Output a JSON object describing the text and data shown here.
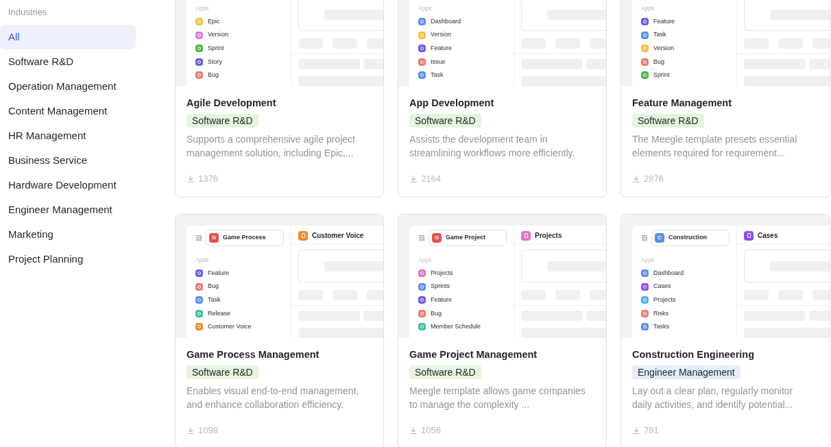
{
  "sidebar": {
    "heading": "Industries",
    "items": [
      {
        "label": "All",
        "selected": true
      },
      {
        "label": "Software R&D",
        "selected": false
      },
      {
        "label": "Operation Management",
        "selected": false
      },
      {
        "label": "Content Management",
        "selected": false
      },
      {
        "label": "HR Management",
        "selected": false
      },
      {
        "label": "Business Service",
        "selected": false
      },
      {
        "label": "Hardware Development",
        "selected": false
      },
      {
        "label": "Engineer Management",
        "selected": false
      },
      {
        "label": "Marketing",
        "selected": false
      },
      {
        "label": "Project Planning",
        "selected": false
      }
    ]
  },
  "templates": [
    {
      "title": "Agile Development",
      "tag": {
        "label": "Software R&D",
        "color": "#e4f5dd"
      },
      "description": "Supports a comprehensive agile project management solution, including Epic,...",
      "downloads": "1376",
      "preview": {
        "apps_label": "Apps",
        "apps": [
          {
            "label": "Epic",
            "color": "#f7c23c"
          },
          {
            "label": "Version",
            "color": "#d77fdd"
          },
          {
            "label": "Sprint",
            "color": "#4cb84c"
          },
          {
            "label": "Story",
            "color": "#6a5ee8"
          },
          {
            "label": "Bug",
            "color": "#ec7b73"
          }
        ]
      }
    },
    {
      "title": "App Development",
      "tag": {
        "label": "Software R&D",
        "color": "#e4f5dd"
      },
      "description": "Assists the development team in streamlining workflows more efficiently.",
      "downloads": "2164",
      "preview": {
        "apps_label": "Apps",
        "apps": [
          {
            "label": "Dashboard",
            "color": "#5b8ff2"
          },
          {
            "label": "Version",
            "color": "#f7c23c"
          },
          {
            "label": "Feature",
            "color": "#6a5ee8"
          },
          {
            "label": "Issue",
            "color": "#ec7b73"
          },
          {
            "label": "Task",
            "color": "#5b8ff2"
          }
        ]
      }
    },
    {
      "title": "Feature Management",
      "tag": {
        "label": "Software R&D",
        "color": "#e4f5dd"
      },
      "description": "The Meegle template presets essential elements required for requirement...",
      "downloads": "2876",
      "preview": {
        "apps_label": "Apps",
        "apps": [
          {
            "label": "Feature",
            "color": "#6a5ee8"
          },
          {
            "label": "Task",
            "color": "#5b8ff2"
          },
          {
            "label": "Version",
            "color": "#f7c23c"
          },
          {
            "label": "Bug",
            "color": "#ec7b73"
          },
          {
            "label": "Sprint",
            "color": "#4cb84c"
          }
        ]
      }
    },
    {
      "title": "Game Process Management",
      "tag": {
        "label": "Software R&D",
        "color": "#e4f5dd"
      },
      "description": "Enables visual end-to-end management, and enhance collaboration efficiency.",
      "downloads": "1098",
      "preview": {
        "space": {
          "letter": "G",
          "color": "#e5524a",
          "name": "Game Process"
        },
        "panel": {
          "title": "Customer Voice",
          "color": "#f08a2c"
        },
        "apps_label": "Apps",
        "apps": [
          {
            "label": "Feature",
            "color": "#6a5ee8"
          },
          {
            "label": "Bug",
            "color": "#ec7b73"
          },
          {
            "label": "Task",
            "color": "#5b8ff2"
          },
          {
            "label": "Release",
            "color": "#3fbf9f"
          },
          {
            "label": "Customer Voice",
            "color": "#f08a2c"
          }
        ]
      }
    },
    {
      "title": "Game Project Management",
      "tag": {
        "label": "Software R&D",
        "color": "#e4f5dd"
      },
      "description": "Meegle template allows game companies to manage the complexity ...",
      "downloads": "1056",
      "preview": {
        "space": {
          "letter": "G",
          "color": "#e5524a",
          "name": "Game Project"
        },
        "panel": {
          "title": "Projects",
          "color": "#e472c4"
        },
        "apps_label": "Apps",
        "apps": [
          {
            "label": "Projects",
            "color": "#e472c4"
          },
          {
            "label": "Sprints",
            "color": "#5b8ff2"
          },
          {
            "label": "Feature",
            "color": "#6a5ee8"
          },
          {
            "label": "Bug",
            "color": "#ec7b73"
          },
          {
            "label": "Member Schedule",
            "color": "#3fbf9f"
          }
        ]
      }
    },
    {
      "title": "Construction Engineering",
      "tag": {
        "label": "Engineer Management",
        "color": "#e5ecfb"
      },
      "description": "Lay out a clear plan, regularly monitor daily activities, and identify potential...",
      "downloads": "791",
      "preview": {
        "space": {
          "letter": "C",
          "color": "#5b8ff2",
          "name": "Construction"
        },
        "panel": {
          "title": "Cases",
          "color": "#8b4ff0"
        },
        "apps_label": "Apps",
        "apps": [
          {
            "label": "Dashboard",
            "color": "#5b8ff2"
          },
          {
            "label": "Cases",
            "color": "#8b4ff0"
          },
          {
            "label": "Projects",
            "color": "#4fb3ee"
          },
          {
            "label": "Risks",
            "color": "#ec7b73"
          },
          {
            "label": "Tasks",
            "color": "#5b8ff2"
          }
        ]
      }
    }
  ]
}
